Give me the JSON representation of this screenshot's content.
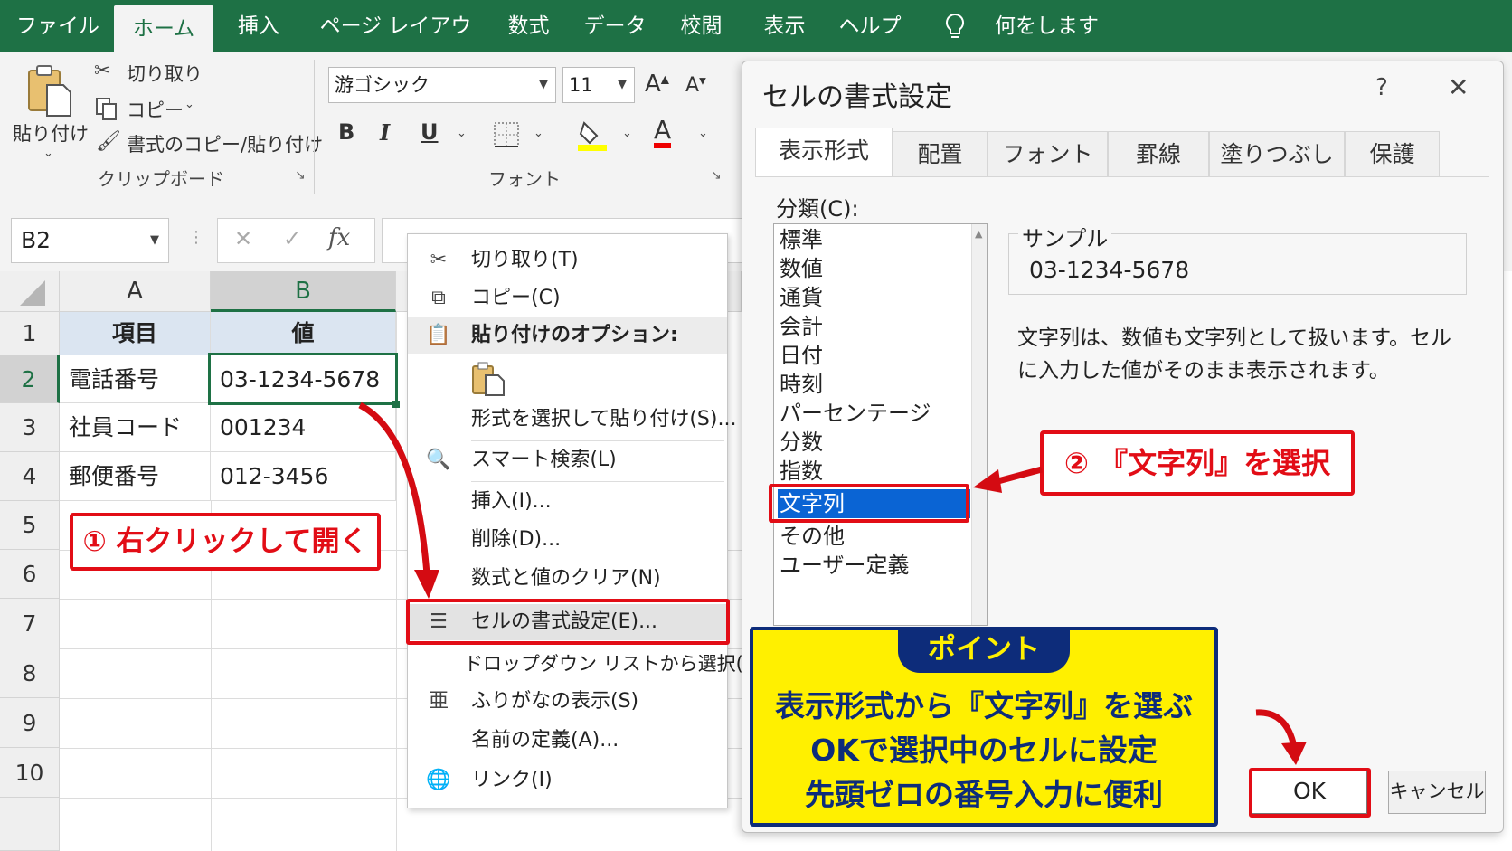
{
  "menu": {
    "tabs": [
      "ファイル",
      "ホーム",
      "挿入",
      "ページ レイアウト",
      "数式",
      "データ",
      "校閲",
      "表示",
      "ヘルプ"
    ],
    "search": "何をしますか"
  },
  "ribbon": {
    "clipboard": {
      "paste": "貼り付け",
      "cut": "切り取り",
      "copy": "コピー",
      "format_painter": "書式のコピー/貼り付け",
      "group": "クリップボード"
    },
    "font": {
      "name": "游ゴシック",
      "size": "11",
      "group": "フォント",
      "bold": "B",
      "italic": "I",
      "underline": "U",
      "grow": "A",
      "shrink": "A",
      "font_color": "A"
    }
  },
  "formula_bar": {
    "name_box": "B2",
    "fx": "fx"
  },
  "sheet": {
    "columns": [
      "A",
      "B"
    ],
    "rows": [
      "1",
      "2",
      "3",
      "4",
      "5",
      "6",
      "7",
      "8",
      "9",
      "10"
    ],
    "header": [
      "項目",
      "値"
    ],
    "data": [
      [
        "電話番号",
        "03-1234-5678"
      ],
      [
        "社員コード",
        "001234"
      ],
      [
        "郵便番号",
        "012-3456"
      ]
    ],
    "step1": "① 右クリックして開く"
  },
  "context_menu": {
    "cut": "切り取り(T)",
    "copy": "コピー(C)",
    "paste_options": "貼り付けのオプション:",
    "paste_special": "形式を選択して貼り付け(S)...",
    "smart_lookup": "スマート検索(L)",
    "insert": "挿入(I)...",
    "delete": "削除(D)...",
    "clear": "数式と値のクリア(N)",
    "format_cells": "セルの書式設定(E)...",
    "dropdown": "ドロップダウン リストから選択(K)...",
    "furigana": "ふりがなの表示(S)",
    "define_name": "名前の定義(A)...",
    "link": "リンク(I)"
  },
  "dialog": {
    "title": "セルの書式設定",
    "help": "?",
    "close": "✕",
    "tabs": [
      "表示形式",
      "配置",
      "フォント",
      "罫線",
      "塗りつぶし",
      "保護"
    ],
    "category_label": "分類(C):",
    "categories": [
      "標準",
      "数値",
      "通貨",
      "会計",
      "日付",
      "時刻",
      "パーセンテージ",
      "分数",
      "指数",
      "文字列",
      "その他",
      "ユーザー定義"
    ],
    "sample_label": "サンプル",
    "sample_value": "03-1234-5678",
    "desc1": "文字列は、数値も文字列として扱います。セル",
    "desc2": "に入力した値がそのまま表示されます。",
    "ok": "OK",
    "cancel": "キャンセル",
    "step2": "② 『文字列』を選択"
  },
  "point": {
    "header": "ポイント",
    "line1": "表示形式から『文字列』を選ぶ",
    "line2": "OKで選択中のセルに設定",
    "line3": "先頭ゼロの番号入力に便利"
  },
  "colors": {
    "excel_green": "#1e7145",
    "annotation_red": "#e20d16",
    "point_yellow": "#fff000",
    "point_navy": "#0d2c7a",
    "selection_blue": "#0a64d4"
  }
}
